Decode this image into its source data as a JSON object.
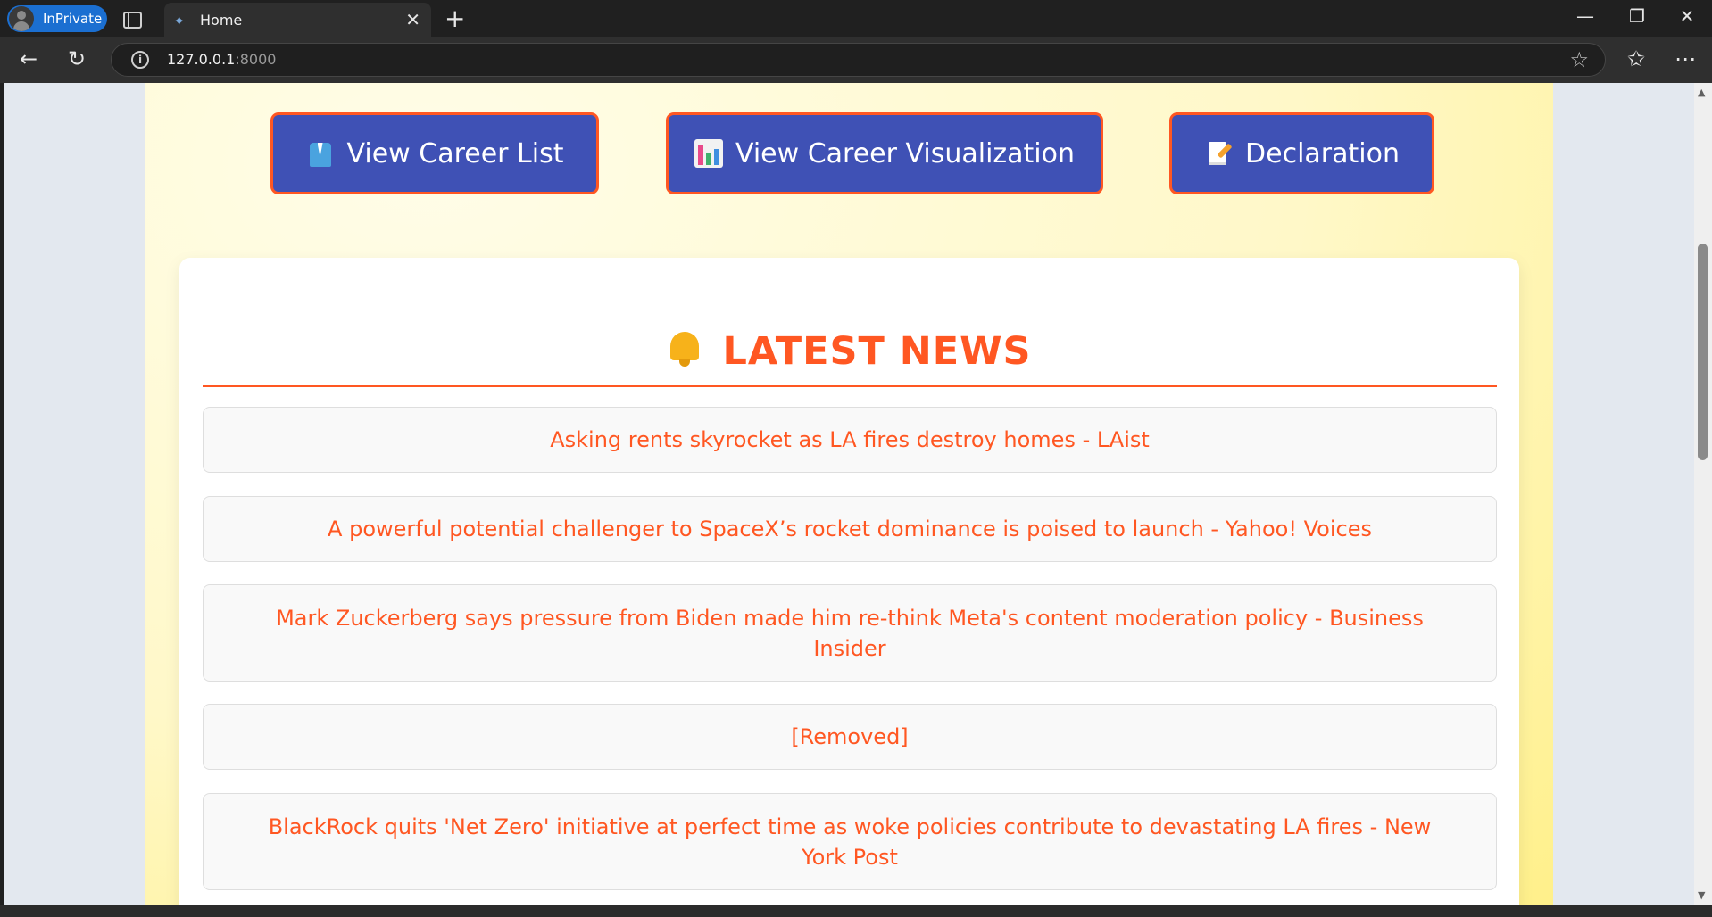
{
  "browser": {
    "profile_label": "InPrivate",
    "tab_title": "Home",
    "url_host": "127.0.0.1",
    "url_port": ":8000"
  },
  "nav": {
    "career_list": "View Career List",
    "career_visualization": "View Career Visualization",
    "declaration": "Declaration"
  },
  "news": {
    "heading": "LATEST NEWS",
    "items": [
      "Asking rents skyrocket as LA fires destroy homes - LAist",
      "A powerful potential challenger to SpaceX’s rocket dominance is poised to launch - Yahoo! Voices",
      "Mark Zuckerberg says pressure from Biden made him re-think Meta's content moderation policy - Business Insider",
      "[Removed]",
      "BlackRock quits 'Net Zero' initiative at perfect time as woke policies contribute to devastating LA fires - New York Post"
    ]
  },
  "colors": {
    "accent": "#ff5722",
    "button_bg": "#3f51b5",
    "page_bg": "#fff8c8"
  }
}
